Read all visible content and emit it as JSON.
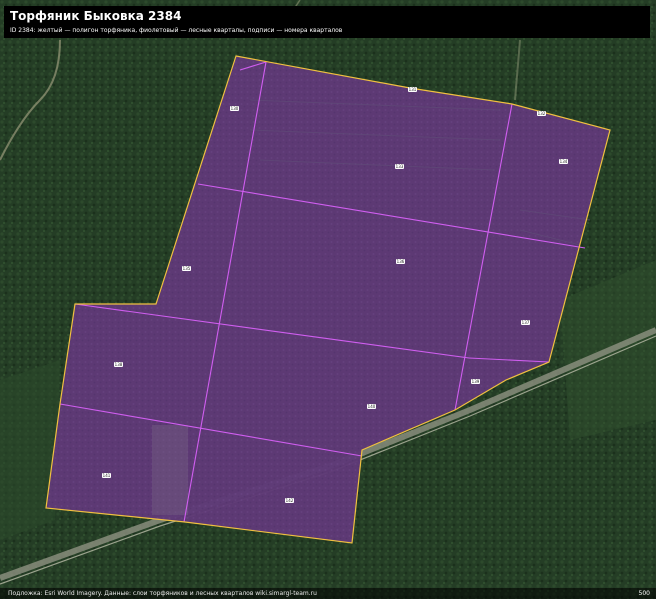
{
  "header": {
    "title": "Торфяник Быковка 2384",
    "subtitle": "ID 2384: желтый — полигон торфяника, фиолетовый — лесные кварталы, подписи — номера кварталов"
  },
  "legend": {
    "peat_color": "#f0c040",
    "quarter_color": "#cc55ee",
    "fill_color": "#6a3a8a"
  },
  "quarter_labels": [
    "130",
    "131",
    "132",
    "133",
    "134",
    "135",
    "136",
    "137",
    "138",
    "139",
    "140",
    "141",
    "142",
    "143",
    "144"
  ],
  "attribution": "Подложка: Esri World Imagery. Данные: слои торфяников и лесных кварталов wiki.simargl-team.ru",
  "scale_label": "500"
}
